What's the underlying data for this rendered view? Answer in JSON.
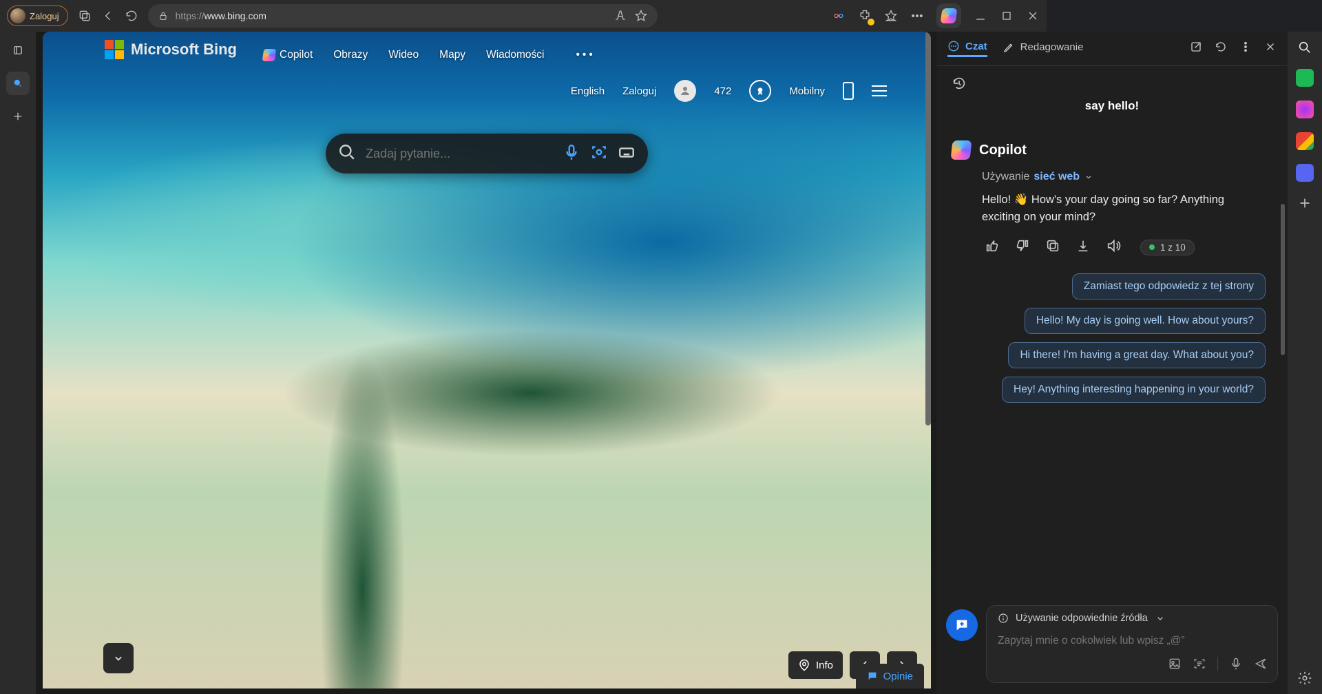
{
  "chrome": {
    "login_label": "Zaloguj",
    "url_scheme": "https://",
    "url_host": "www.bing.com"
  },
  "bing": {
    "logo_text": "Microsoft Bing",
    "nav": {
      "copilot": "Copilot",
      "images": "Obrazy",
      "video": "Wideo",
      "maps": "Mapy",
      "news": "Wiadomości"
    },
    "row2": {
      "english": "English",
      "login": "Zaloguj",
      "points": "472",
      "mobile": "Mobilny"
    },
    "search_placeholder": "Zadaj pytanie...",
    "info_label": "Info",
    "feedback_label": "Opinie"
  },
  "sidepanel": {
    "tabs": {
      "chat": "Czat",
      "compose": "Redagowanie"
    },
    "truncated": "say hello!",
    "copilot_name": "Copilot",
    "using_prefix": "Używanie",
    "using_source": "sieć web",
    "reply": "Hello! 👋 How's your day going so far? Anything exciting on your mind?",
    "counter": "1 z 10",
    "suggestions": [
      "Zamiast tego odpowiedz z tej strony",
      "Hello! My day is going well. How about yours?",
      "Hi there! I'm having a great day. What about you?",
      "Hey! Anything interesting happening in your world?"
    ],
    "source_hint": "Używanie odpowiednie źródła",
    "ask_placeholder": "Zapytaj mnie o cokolwiek lub wpisz „@”"
  }
}
